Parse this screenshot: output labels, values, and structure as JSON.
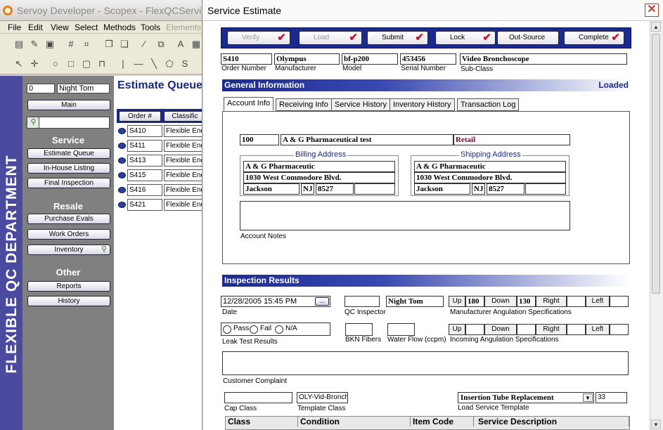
{
  "app": {
    "title": "Servoy Developer - Scopex - FlexQCService",
    "menu": [
      "File",
      "Edit",
      "View",
      "Select",
      "Methods",
      "Tools",
      "Elements"
    ]
  },
  "department": {
    "label": "FLEXIBLE QC DEPARTMENT",
    "user_number": "0",
    "user_name": "Night Tom",
    "main_button": "Main",
    "service_heading": "Service",
    "service_buttons": [
      "Estimate Queue",
      "In-House Listing",
      "Final Inspection"
    ],
    "resale_heading": "Resale",
    "resale_buttons": [
      "Purchase Evals",
      "Work Orders",
      "Inventory"
    ],
    "other_heading": "Other",
    "other_buttons": [
      "Reports",
      "History"
    ]
  },
  "queue": {
    "title": "Estimate Queue",
    "columns": [
      "Order #",
      "Classific"
    ],
    "rows": [
      {
        "order": "S410",
        "class": "Flexible Endo"
      },
      {
        "order": "S411",
        "class": "Flexible Endo"
      },
      {
        "order": "S413",
        "class": "Flexible Endo"
      },
      {
        "order": "S415",
        "class": "Flexible Endo"
      },
      {
        "order": "S416",
        "class": "Flexible Endo"
      },
      {
        "order": "S421",
        "class": "Flexible Endo"
      }
    ]
  },
  "dialog": {
    "title": "Service Estimate",
    "close_glyph": "✕",
    "status_buttons": [
      {
        "label": "Verify",
        "checked": true,
        "enabled": false
      },
      {
        "label": "Load",
        "checked": true,
        "enabled": false
      },
      {
        "label": "Submit",
        "checked": true,
        "enabled": true
      },
      {
        "label": "Lock",
        "checked": true,
        "enabled": true
      },
      {
        "label": "Out-Source",
        "checked": false,
        "enabled": true
      },
      {
        "label": "Complete",
        "checked": true,
        "enabled": true
      }
    ],
    "check_glyph": "✔",
    "header": {
      "order_number": {
        "label": "Order Number",
        "value": "S410"
      },
      "manufacturer": {
        "label": "Manufacturer",
        "value": "Olympus"
      },
      "model": {
        "label": "Model",
        "value": "bf-p200"
      },
      "serial_number": {
        "label": "Serial Number",
        "value": "453456"
      },
      "sub_class": {
        "label": "Sub-Class",
        "value": "Video Bronchoscope"
      }
    },
    "general_info": {
      "title": "General Information",
      "status": "Loaded",
      "tabs": [
        "Account Info",
        "Receiving Info",
        "Service History",
        "Inventory History",
        "Transaction Log"
      ],
      "active_tab": "Account Info",
      "account": {
        "number": "100",
        "name": "A & G Pharmaceutical test",
        "type": "Retail",
        "type_color": "#7a0030"
      },
      "billing": {
        "legend": "Billing Address",
        "name": "A & G Pharmaceutic",
        "street": "1030 West Commodore Blvd.",
        "city": "Jackson",
        "state": "NJ",
        "zip": "8527",
        "extra": ""
      },
      "shipping": {
        "legend": "Shipping Address",
        "name": "A & G Pharmaceutic",
        "street": "1030 West Commodore Blvd.",
        "city": "Jackson",
        "state": "NJ",
        "zip": "8527",
        "extra": ""
      },
      "notes_label": "Account Notes",
      "notes": ""
    },
    "inspection": {
      "title": "Inspection Results",
      "date": {
        "label": "Date",
        "value": "12/28/2005   15:45 PM",
        "button": "..."
      },
      "qc_inspector": {
        "label": "QC Inspector",
        "value": ""
      },
      "inspector_name": "Night Tom",
      "mfr_angulation": {
        "label": "Manufacturer Angulation Specifications",
        "up_label": "Up",
        "up": "180",
        "down_label": "Down",
        "down": "130",
        "right_label": "Right",
        "right": "",
        "left_label": "Left",
        "left": ""
      },
      "leak_test": {
        "label": "Leak Test Results",
        "options": [
          "Pass",
          "Fail",
          "N/A"
        ]
      },
      "bkn_fibers": {
        "label": "BKN  Fibers",
        "value": ""
      },
      "water_flow": {
        "label": "Water Flow (ccpm)",
        "value": ""
      },
      "incoming_angulation": {
        "label": "Incoming Angulation Specifications",
        "up_label": "Up",
        "up": "",
        "down_label": "Down",
        "down": "",
        "right_label": "Right",
        "right": "",
        "left_label": "Left",
        "left": ""
      },
      "customer_complaint": {
        "label": "Customer Complaint",
        "value": ""
      },
      "cap_class": {
        "label": "Cap Class",
        "value": ""
      },
      "template_class": {
        "label": "Template Class",
        "value": "OLY-Vid-Bronch"
      },
      "load_template": {
        "label": "Load Service Template",
        "value": "Insertion Tube Replacement",
        "code": "33"
      }
    },
    "grid": {
      "columns": [
        "Class",
        "Condition",
        "Item Code",
        "Service Description"
      ]
    }
  }
}
